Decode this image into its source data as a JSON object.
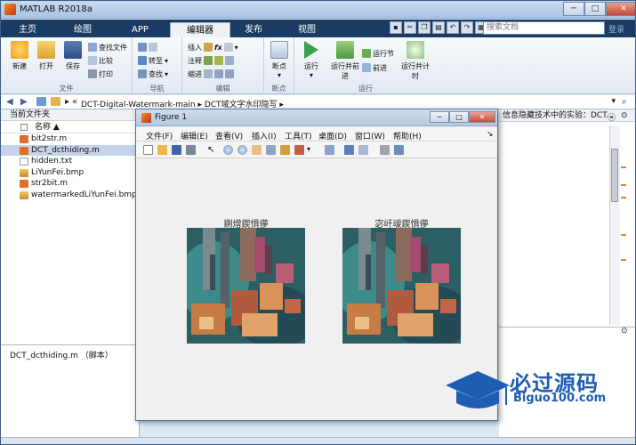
{
  "window": {
    "title": "MATLAB R2018a"
  },
  "tabs": [
    "主页",
    "绘图",
    "APP",
    "编辑器",
    "发布",
    "视图"
  ],
  "search": {
    "placeholder": "搜索文档"
  },
  "login": "登录",
  "ribbon": {
    "file": {
      "label": "文件",
      "new": "新建",
      "open": "打开",
      "save": "保存",
      "find_files": "查找文件",
      "compare": "比较",
      "print": "打印"
    },
    "nav": {
      "label": "导航",
      "goto": "转至",
      "find": "查找"
    },
    "edit": {
      "label": "编辑",
      "insert": "插入",
      "comment": "注释",
      "indent": "缩进"
    },
    "breakpoints": {
      "label": "断点",
      "breakpoints": "断点"
    },
    "run": {
      "label": "运行",
      "run": "运行",
      "run_advance": "运行并前进",
      "run_section": "运行节",
      "advance": "前进",
      "run_time": "运行并计时"
    }
  },
  "address": {
    "path1": "DCT-Digital-Watermark-main",
    "path2": "DCT域文字水印隐写",
    "separator": "«"
  },
  "file_panel": {
    "header": "当前文件夹",
    "col_name": "名称 ▲",
    "files": [
      "bit2str.m",
      "DCT_dcthiding.m",
      "hidden.txt",
      "LiYunFei.bmp",
      "str2bit.m",
      "watermarkedLiYunFei.bmp"
    ]
  },
  "detail_panel": {
    "label": "DCT_dcthiding.m （脚本）"
  },
  "right_panel": {
    "header": "信息隐藏技术中的实验：DCT..."
  },
  "figure": {
    "title": "Figure 1",
    "menu": [
      "文件(F)",
      "编辑(E)",
      "查看(V)",
      "插入(I)",
      "工具(T)",
      "桌面(D)",
      "窗口(W)",
      "帮助(H)"
    ],
    "axes_titles": [
      "鍘熷鍥惧儚",
      "宓屽叆鍥惧儚"
    ]
  },
  "watermark": {
    "cn": "必过源码",
    "en": "Biguo100.com"
  }
}
